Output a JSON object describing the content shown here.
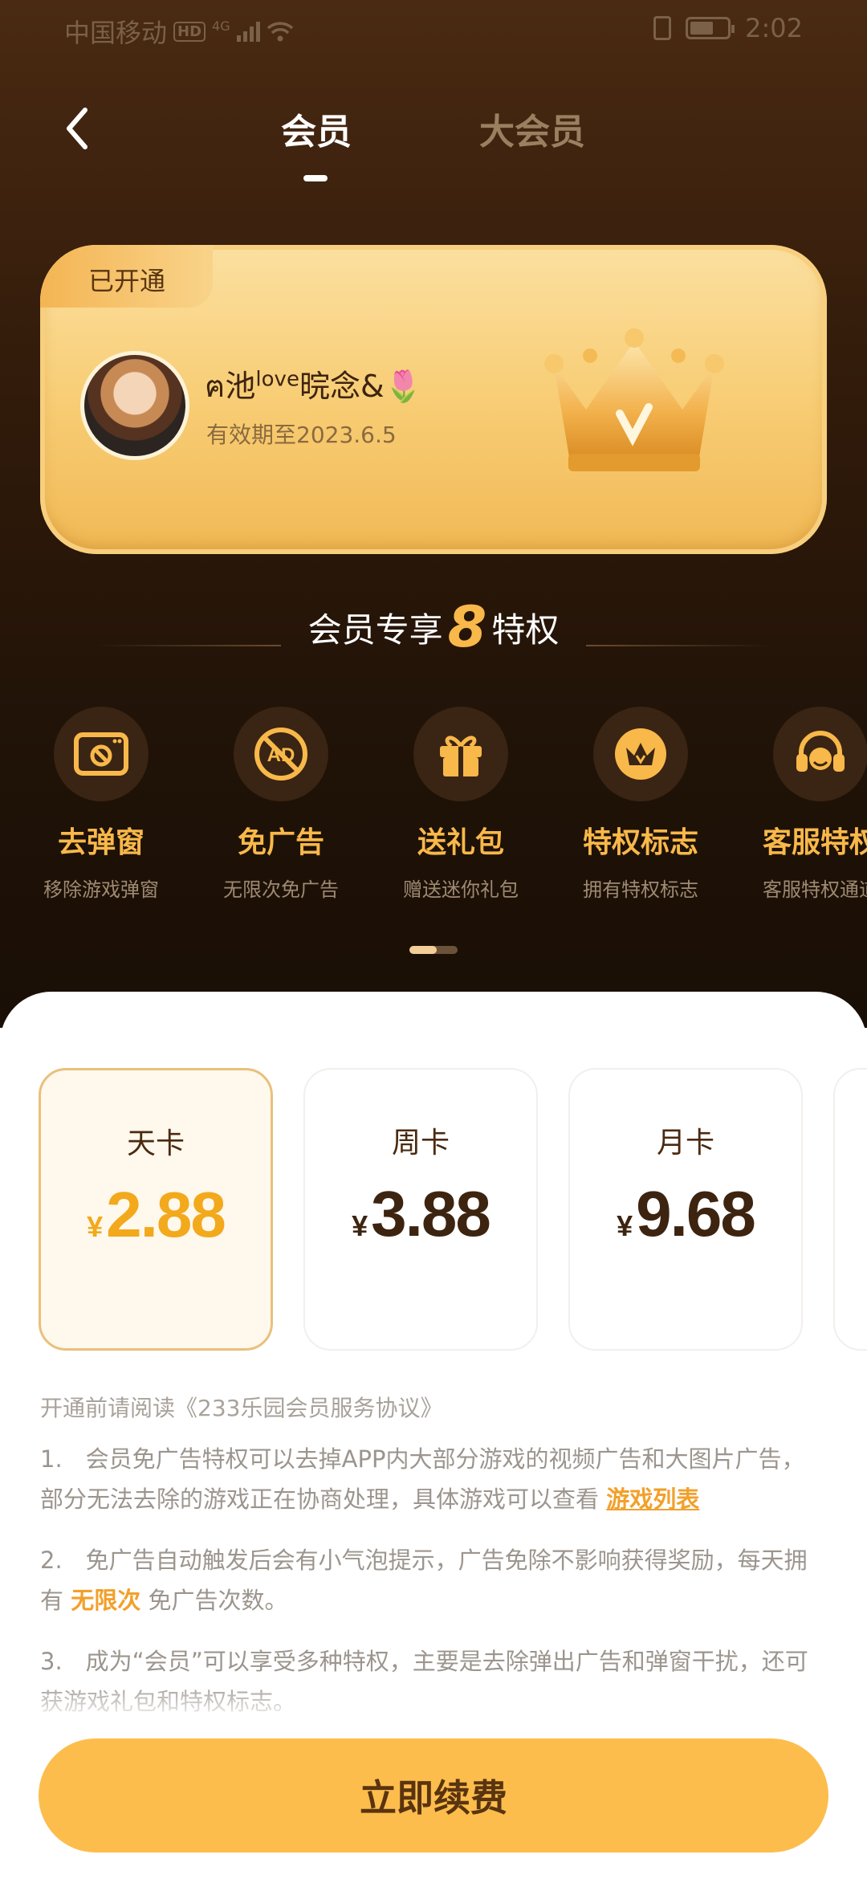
{
  "status_bar": {
    "carrier": "中国移动",
    "hd": "HD",
    "network": "4G",
    "time": "2:02"
  },
  "nav": {
    "tabs": [
      {
        "label": "会员",
        "active": true
      },
      {
        "label": "大会员",
        "active": false
      }
    ]
  },
  "card": {
    "tag": "已开通",
    "username_prefix": "ฅ池",
    "username_sup": "love",
    "username_suffix": "晥念&🌷",
    "validity": "有效期至2023.6.5"
  },
  "privileges": {
    "title_prefix": "会员专享",
    "count": "8",
    "title_suffix": "特权",
    "items": [
      {
        "name": "去弹窗",
        "desc": "移除游戏弹窗",
        "icon": "popup-icon"
      },
      {
        "name": "免广告",
        "desc": "无限次免广告",
        "icon": "no-ad-icon"
      },
      {
        "name": "送礼包",
        "desc": "赠送迷你礼包",
        "icon": "gift-icon"
      },
      {
        "name": "特权标志",
        "desc": "拥有特权标志",
        "icon": "crown-badge-icon"
      },
      {
        "name": "客服特权",
        "desc": "客服特权通道",
        "icon": "headset-icon"
      }
    ],
    "page_index": 0
  },
  "plans": [
    {
      "name": "天卡",
      "currency": "¥",
      "price": "2.88",
      "selected": true
    },
    {
      "name": "周卡",
      "currency": "¥",
      "price": "3.88",
      "selected": false
    },
    {
      "name": "月卡",
      "currency": "¥",
      "price": "9.68",
      "selected": false
    }
  ],
  "agreement": "开通前请阅读《233乐园会员服务协议》",
  "notes": {
    "n1_text": "1.　会员免广告特权可以去掉APP内大部分游戏的视频广告和大图片广告，部分无法去除的游戏正在协商处理，具体游戏可以查看 ",
    "n1_link": "游戏列表",
    "n2_text_a": "2.　免广告自动触发后会有小气泡提示，广告免除不影响获得奖励，每天拥有 ",
    "n2_hl": "无限次",
    "n2_text_b": " 免广告次数。",
    "n3_text": "3.　成为“会员”可以享受多种特权，主要是去除弹出广告和弹窗干扰，还可获游戏礼包和特权标志。"
  },
  "cta": "立即续费",
  "colors": {
    "accent": "#f8b84a",
    "button": "#fdbd4c",
    "card": "#f8cd75",
    "dark_bg": "#2a1809"
  }
}
